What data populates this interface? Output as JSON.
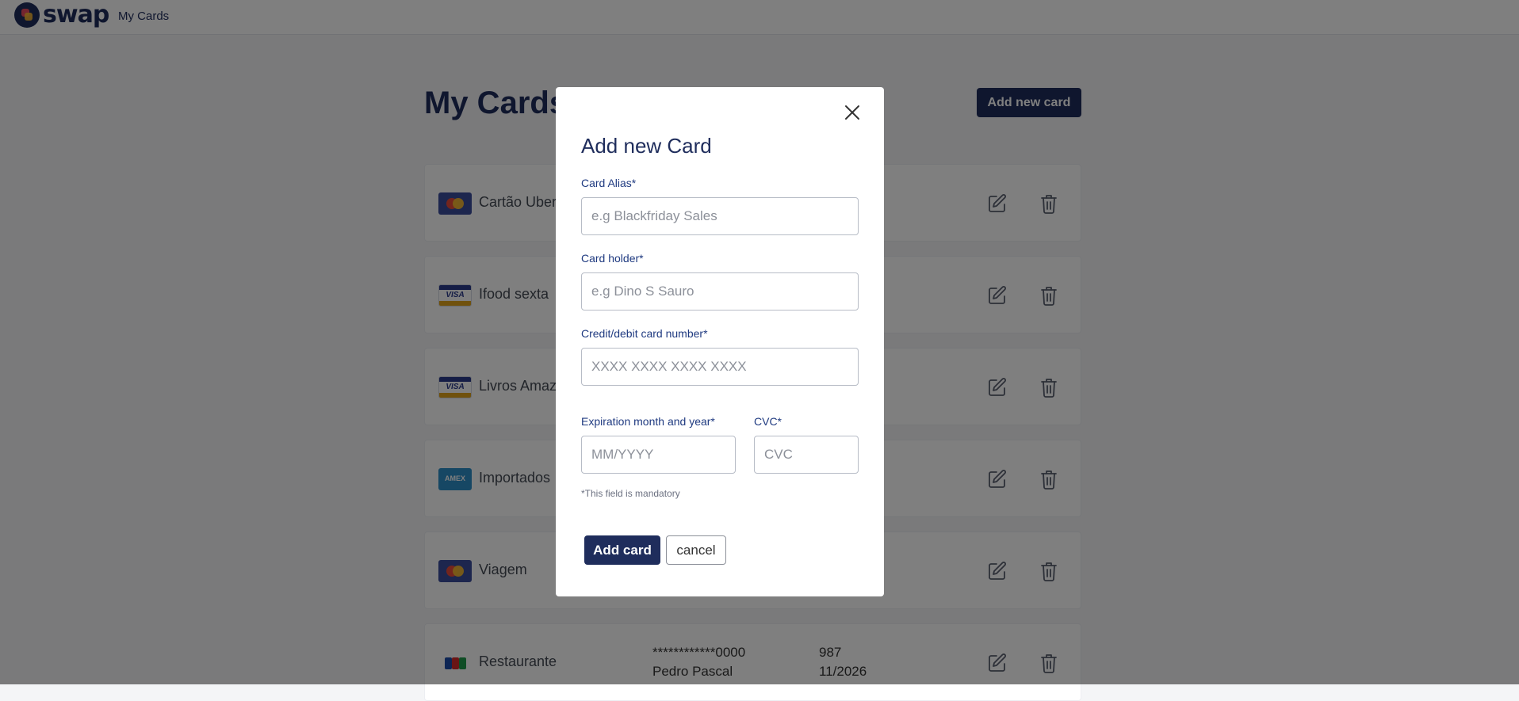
{
  "header": {
    "logo_text": "swap",
    "nav_link": "My Cards"
  },
  "page": {
    "title": "My Cards",
    "add_new_card_label": "Add new card"
  },
  "cards": [
    {
      "alias": "Cartão Uber",
      "brand": "mastercard",
      "number": "",
      "holder": "",
      "cvc": "",
      "expiration": ""
    },
    {
      "alias": "Ifood sexta",
      "brand": "visa",
      "number": "",
      "holder": "",
      "cvc": "",
      "expiration": ""
    },
    {
      "alias": "Livros Amazon",
      "brand": "visa",
      "number": "",
      "holder": "",
      "cvc": "",
      "expiration": ""
    },
    {
      "alias": "Importados",
      "brand": "amex",
      "number": "",
      "holder": "",
      "cvc": "",
      "expiration": ""
    },
    {
      "alias": "Viagem",
      "brand": "mastercard",
      "number": "",
      "holder": "",
      "cvc": "",
      "expiration": ""
    },
    {
      "alias": "Restaurante",
      "brand": "jcb",
      "number": "************0000",
      "holder": "Pedro Pascal",
      "cvc": "987",
      "expiration": "11/2026"
    }
  ],
  "brand_labels": {
    "visa": "VISA",
    "amex": "AMEX"
  },
  "modal": {
    "title": "Add new Card",
    "alias": {
      "label": "Card Alias*",
      "placeholder": "e.g Blackfriday Sales",
      "value": ""
    },
    "holder": {
      "label": "Card holder*",
      "placeholder": "e.g Dino S Sauro",
      "value": ""
    },
    "number": {
      "label": "Credit/debit card number*",
      "placeholder": "XXXX XXXX XXXX XXXX",
      "value": ""
    },
    "expiration": {
      "label": "Expiration month and year*",
      "placeholder": "MM/YYYY",
      "value": ""
    },
    "cvc": {
      "label": "CVC*",
      "placeholder": "CVC",
      "value": ""
    },
    "mandatory_note": "*This field is mandatory",
    "submit_label": "Add card",
    "cancel_label": "cancel"
  },
  "colors": {
    "brand_navy": "#1f2d5c",
    "overlay": "rgba(0,0,0,0.5)"
  }
}
